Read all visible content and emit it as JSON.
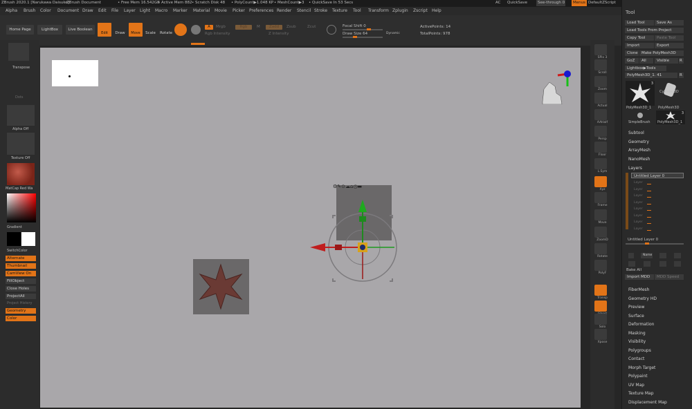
{
  "title_bar": {
    "app": "ZBrush 2020.1 [Narukawa Daisuke]",
    "document": "ZBrush Document",
    "free_mem": "• Free Mem 16.542GB",
    "active_mem": "• Active Mem 882",
    "scratch_disk": "• Scratch Disk 48",
    "polycount": "• PolyCount▶1.048 KP",
    "meshcount": "• MeshCount▶3",
    "quicksave": "• QuickSave In 53 Secs",
    "ac": "AC",
    "quicksave_btn": "QuickSave",
    "see_through": "See-through 0",
    "menus_btn": "Menus",
    "default_zscript": "DefaultZScript"
  },
  "menu_bar": [
    "Alpha",
    "Brush",
    "Color",
    "Document",
    "Draw",
    "Edit",
    "File",
    "Layer",
    "Light",
    "Macro",
    "Marker",
    "Material",
    "Movie",
    "Picker",
    "Preferences",
    "Render",
    "Stencil",
    "Stroke",
    "Texture",
    "Tool",
    "Transform",
    "Zplugin",
    "Zscript",
    "Help"
  ],
  "toolbar": {
    "home_page": "Home Page",
    "lightbox": "LightBox",
    "live_boolean": "Live Boolean",
    "edit": "Edit",
    "draw": "Draw",
    "move": "Move",
    "scale": "Scale",
    "rotate": "Rotate",
    "a_btn": "A",
    "mrgb": "Mrgb",
    "rgb": "Rgb",
    "m": "M",
    "zadd": "Zadd",
    "zsub": "Zsub",
    "zcut": "Zcut",
    "rgb_intensity": "Rgb Intensity",
    "z_intensity": "Z Intensity",
    "focal_shift": "Focal Shift 0",
    "draw_size": "Draw Size 64",
    "dynamic": "Dynamic",
    "active_points": "ActivePoints: 14",
    "total_points": "TotalPoints: 978"
  },
  "left_shelf": {
    "transpose": "Transpose",
    "dots": "Dots",
    "alpha_off": "Alpha Off",
    "texture_off": "Texture Off",
    "matcap": "MatCap Red Wa",
    "gradient": "Gradient",
    "switch_color": "SwitchColor",
    "alternate": "Alternate",
    "thumbnail": "Thumbnail",
    "camview_on": "CamView On",
    "fill_object": "FillObject",
    "close_holes": "Close Holes",
    "project_all": "ProjectAll",
    "project_history": "Project History",
    "geometry": "Geometry",
    "color": "Color"
  },
  "right_shelf": [
    "SPix 3",
    "Scroll",
    "Zoom",
    "Actual",
    "AAHalf",
    "Persp",
    "Floor",
    "L.Sym",
    "Xyz",
    "Frame",
    "Move",
    "ZoomD",
    "Rotate",
    "PolyF",
    "Transp",
    "Ghost",
    "Solo",
    "Xpose"
  ],
  "tool_panel": {
    "title": "Tool",
    "load_tool": "Load Tool",
    "save_as": "Save As",
    "load_tools_from_project": "Load Tools From Project",
    "copy_tool": "Copy Tool",
    "paste_tool": "Paste Tool",
    "import": "Import",
    "export": "Export",
    "clone": "Clone",
    "make_polymesh": "Make PolyMesh3D",
    "goz": "GoZ",
    "all": "All",
    "visible": "Visible",
    "r": "R",
    "lightbox_tools": "Lightbox▶Tools",
    "current_tool": "PolyMesh3D_1. 41",
    "r2": "R",
    "thumbs": [
      {
        "label": "PolyMesh3D_1",
        "badge": "3"
      },
      {
        "label": "Cylinder3D",
        "badge": ""
      },
      {
        "label": "SimpleBrush",
        "badge": ""
      },
      {
        "label": "PolyMesh3D_1",
        "badge": "3"
      }
    ],
    "sub_poly": "PolyMesh3D",
    "sections_top": [
      "Subtool",
      "Geometry",
      "ArrayMesh",
      "NanoMesh",
      "Layers"
    ],
    "layer_name": "Untitled Layer 0",
    "layer_rows": [
      "Layer",
      "Layer",
      "Layer",
      "Layer",
      "Layer",
      "Layer",
      "Layer",
      "Layer"
    ],
    "layer_bottom": "Untitled Layer 0",
    "name_btn": "Name",
    "bake_all": "Bake All",
    "import_mdd": "Import MDD",
    "mdd_speed": "MDD Speed",
    "sections_bottom": [
      "FiberMesh",
      "Geometry HD",
      "Preview",
      "Surface",
      "Deformation",
      "Masking",
      "Visibility",
      "Polygroups",
      "Contact",
      "Morph Target",
      "Polypaint",
      "UV Map",
      "Texture Map",
      "Displacement Map"
    ]
  },
  "colors": {
    "accent": "#e27418",
    "canvas": "#a9a7aa",
    "panel": "#2a2a2a"
  }
}
